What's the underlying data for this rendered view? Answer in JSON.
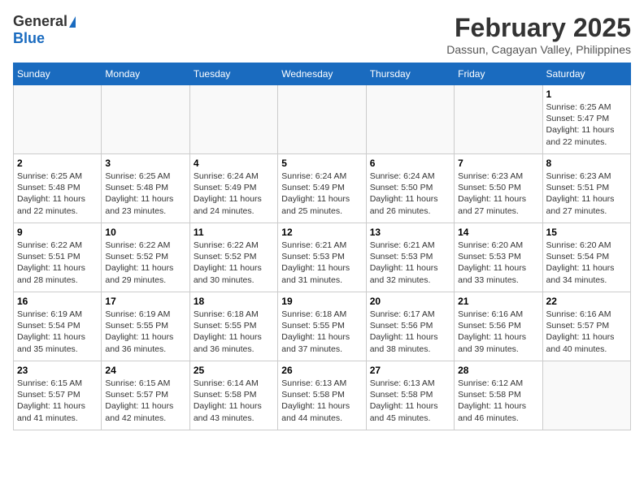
{
  "logo": {
    "general": "General",
    "blue": "Blue"
  },
  "title": {
    "month_year": "February 2025",
    "location": "Dassun, Cagayan Valley, Philippines"
  },
  "weekdays": [
    "Sunday",
    "Monday",
    "Tuesday",
    "Wednesday",
    "Thursday",
    "Friday",
    "Saturday"
  ],
  "weeks": [
    [
      {
        "day": "",
        "info": ""
      },
      {
        "day": "",
        "info": ""
      },
      {
        "day": "",
        "info": ""
      },
      {
        "day": "",
        "info": ""
      },
      {
        "day": "",
        "info": ""
      },
      {
        "day": "",
        "info": ""
      },
      {
        "day": "1",
        "info": "Sunrise: 6:25 AM\nSunset: 5:47 PM\nDaylight: 11 hours\nand 22 minutes."
      }
    ],
    [
      {
        "day": "2",
        "info": "Sunrise: 6:25 AM\nSunset: 5:48 PM\nDaylight: 11 hours\nand 22 minutes."
      },
      {
        "day": "3",
        "info": "Sunrise: 6:25 AM\nSunset: 5:48 PM\nDaylight: 11 hours\nand 23 minutes."
      },
      {
        "day": "4",
        "info": "Sunrise: 6:24 AM\nSunset: 5:49 PM\nDaylight: 11 hours\nand 24 minutes."
      },
      {
        "day": "5",
        "info": "Sunrise: 6:24 AM\nSunset: 5:49 PM\nDaylight: 11 hours\nand 25 minutes."
      },
      {
        "day": "6",
        "info": "Sunrise: 6:24 AM\nSunset: 5:50 PM\nDaylight: 11 hours\nand 26 minutes."
      },
      {
        "day": "7",
        "info": "Sunrise: 6:23 AM\nSunset: 5:50 PM\nDaylight: 11 hours\nand 27 minutes."
      },
      {
        "day": "8",
        "info": "Sunrise: 6:23 AM\nSunset: 5:51 PM\nDaylight: 11 hours\nand 27 minutes."
      }
    ],
    [
      {
        "day": "9",
        "info": "Sunrise: 6:22 AM\nSunset: 5:51 PM\nDaylight: 11 hours\nand 28 minutes."
      },
      {
        "day": "10",
        "info": "Sunrise: 6:22 AM\nSunset: 5:52 PM\nDaylight: 11 hours\nand 29 minutes."
      },
      {
        "day": "11",
        "info": "Sunrise: 6:22 AM\nSunset: 5:52 PM\nDaylight: 11 hours\nand 30 minutes."
      },
      {
        "day": "12",
        "info": "Sunrise: 6:21 AM\nSunset: 5:53 PM\nDaylight: 11 hours\nand 31 minutes."
      },
      {
        "day": "13",
        "info": "Sunrise: 6:21 AM\nSunset: 5:53 PM\nDaylight: 11 hours\nand 32 minutes."
      },
      {
        "day": "14",
        "info": "Sunrise: 6:20 AM\nSunset: 5:53 PM\nDaylight: 11 hours\nand 33 minutes."
      },
      {
        "day": "15",
        "info": "Sunrise: 6:20 AM\nSunset: 5:54 PM\nDaylight: 11 hours\nand 34 minutes."
      }
    ],
    [
      {
        "day": "16",
        "info": "Sunrise: 6:19 AM\nSunset: 5:54 PM\nDaylight: 11 hours\nand 35 minutes."
      },
      {
        "day": "17",
        "info": "Sunrise: 6:19 AM\nSunset: 5:55 PM\nDaylight: 11 hours\nand 36 minutes."
      },
      {
        "day": "18",
        "info": "Sunrise: 6:18 AM\nSunset: 5:55 PM\nDaylight: 11 hours\nand 36 minutes."
      },
      {
        "day": "19",
        "info": "Sunrise: 6:18 AM\nSunset: 5:55 PM\nDaylight: 11 hours\nand 37 minutes."
      },
      {
        "day": "20",
        "info": "Sunrise: 6:17 AM\nSunset: 5:56 PM\nDaylight: 11 hours\nand 38 minutes."
      },
      {
        "day": "21",
        "info": "Sunrise: 6:16 AM\nSunset: 5:56 PM\nDaylight: 11 hours\nand 39 minutes."
      },
      {
        "day": "22",
        "info": "Sunrise: 6:16 AM\nSunset: 5:57 PM\nDaylight: 11 hours\nand 40 minutes."
      }
    ],
    [
      {
        "day": "23",
        "info": "Sunrise: 6:15 AM\nSunset: 5:57 PM\nDaylight: 11 hours\nand 41 minutes."
      },
      {
        "day": "24",
        "info": "Sunrise: 6:15 AM\nSunset: 5:57 PM\nDaylight: 11 hours\nand 42 minutes."
      },
      {
        "day": "25",
        "info": "Sunrise: 6:14 AM\nSunset: 5:58 PM\nDaylight: 11 hours\nand 43 minutes."
      },
      {
        "day": "26",
        "info": "Sunrise: 6:13 AM\nSunset: 5:58 PM\nDaylight: 11 hours\nand 44 minutes."
      },
      {
        "day": "27",
        "info": "Sunrise: 6:13 AM\nSunset: 5:58 PM\nDaylight: 11 hours\nand 45 minutes."
      },
      {
        "day": "28",
        "info": "Sunrise: 6:12 AM\nSunset: 5:58 PM\nDaylight: 11 hours\nand 46 minutes."
      },
      {
        "day": "",
        "info": ""
      }
    ]
  ]
}
